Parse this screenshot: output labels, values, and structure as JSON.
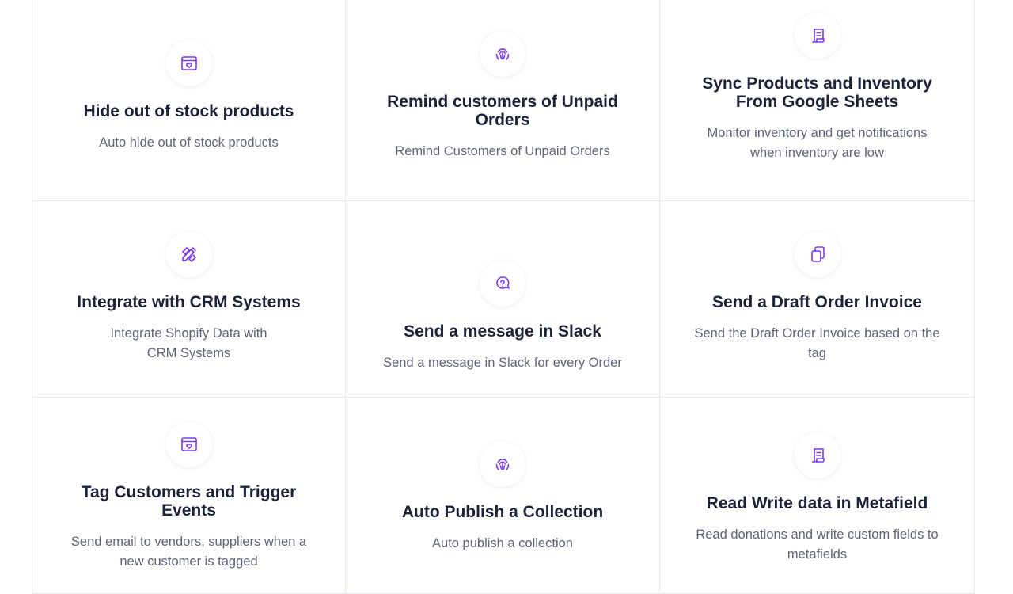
{
  "colors": {
    "accent": "#7c3aed",
    "title": "#1c2338",
    "description": "#5d6577",
    "border": "#e6e9ed"
  },
  "cards": [
    {
      "icon": "browser-heart-icon",
      "title": "Hide out of stock products",
      "description": "Auto hide out of stock products"
    },
    {
      "icon": "fingerprint-icon",
      "title": "Remind customers of Unpaid Orders",
      "description": "Remind Customers of Unpaid Orders"
    },
    {
      "icon": "scroll-icon",
      "title": "Sync Products and Inventory From Google Sheets",
      "description": "Monitor inventory and get notifications when inventory are low"
    },
    {
      "icon": "pencil-ruler-icon",
      "title": "Integrate with CRM Systems",
      "description": "Integrate Shopify Data with CRM Systems"
    },
    {
      "icon": "chat-question-icon",
      "title": "Send a message in Slack",
      "description": "Send a message in Slack for every Order"
    },
    {
      "icon": "copy-icon",
      "title": "Send a Draft Order Invoice",
      "description": "Send the Draft Order Invoice based on the tag"
    },
    {
      "icon": "browser-heart-icon",
      "title": "Tag Customers and Trigger Events",
      "description": "Send email to vendors, suppliers when a new customer is tagged"
    },
    {
      "icon": "fingerprint-icon",
      "title": "Auto Publish a Collection",
      "description": "Auto publish a collection"
    },
    {
      "icon": "scroll-icon",
      "title": "Read Write data in Metafield",
      "description": "Read donations and write custom fields to metafields"
    }
  ]
}
